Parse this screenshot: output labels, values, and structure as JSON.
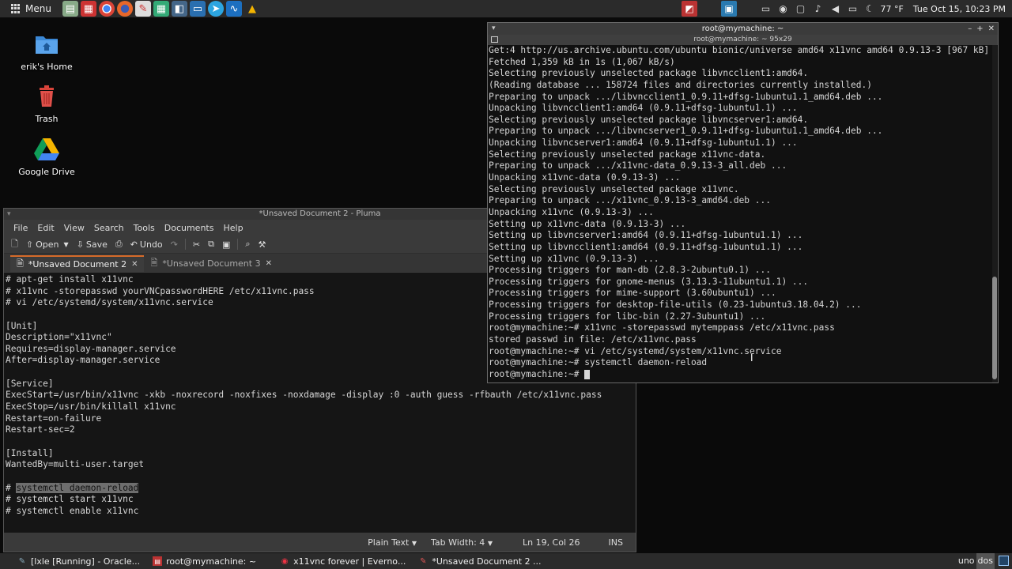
{
  "top_panel": {
    "menu_label": "Menu",
    "clock": "Tue Oct 15, 10:23 PM",
    "weather": "77 °F",
    "launchers": [
      "files-icon",
      "presentation-icon",
      "chrome-icon",
      "firefox-icon",
      "text-editor-icon",
      "spreadsheet-icon",
      "screenshot-icon",
      "remote-desktop-icon",
      "telegram-icon",
      "waveform-icon",
      "google-drive-icon"
    ]
  },
  "desktop": {
    "icons": [
      {
        "label": "erik's Home"
      },
      {
        "label": "Trash"
      },
      {
        "label": "Google Drive"
      }
    ]
  },
  "pluma": {
    "title": "*Unsaved Document 2 - Pluma",
    "menu": [
      "File",
      "Edit",
      "View",
      "Search",
      "Tools",
      "Documents",
      "Help"
    ],
    "toolbar": {
      "open": "Open",
      "save": "Save",
      "undo": "Undo"
    },
    "tabs": [
      {
        "label": "*Unsaved Document 2"
      },
      {
        "label": "*Unsaved Document 3"
      }
    ],
    "lines": [
      "# apt-get install x11vnc",
      "# x11vnc -storepasswd yourVNCpasswordHERE /etc/x11vnc.pass",
      "# vi /etc/systemd/system/x11vnc.service",
      "",
      "[Unit]",
      "Description=\"x11vnc\"",
      "Requires=display-manager.service",
      "After=display-manager.service",
      "",
      "[Service]",
      "ExecStart=/usr/bin/x11vnc -xkb -noxrecord -noxfixes -noxdamage -display :0 -auth guess -rfbauth /etc/x11vnc.pass",
      "ExecStop=/usr/bin/killall x11vnc",
      "Restart=on-failure",
      "Restart-sec=2",
      "",
      "[Install]",
      "WantedBy=multi-user.target",
      "",
      "# ",
      "# systemctl start x11vnc",
      "# systemctl enable x11vnc"
    ],
    "selected_text": "systemctl daemon-reload",
    "status": {
      "mode": "Plain Text",
      "tab_width": "Tab Width:  4",
      "position": "Ln 19, Col 26",
      "ins": "INS"
    }
  },
  "terminal": {
    "title": "root@mymachine: ~",
    "subtitle": "root@mymachine: ~ 95x29",
    "lines": [
      "Get:4 http://us.archive.ubuntu.com/ubuntu bionic/universe amd64 x11vnc amd64 0.9.13-3 [967 kB]",
      "Fetched 1,359 kB in 1s (1,067 kB/s)",
      "Selecting previously unselected package libvncclient1:amd64.",
      "(Reading database ... 158724 files and directories currently installed.)",
      "Preparing to unpack .../libvncclient1_0.9.11+dfsg-1ubuntu1.1_amd64.deb ...",
      "Unpacking libvncclient1:amd64 (0.9.11+dfsg-1ubuntu1.1) ...",
      "Selecting previously unselected package libvncserver1:amd64.",
      "Preparing to unpack .../libvncserver1_0.9.11+dfsg-1ubuntu1.1_amd64.deb ...",
      "Unpacking libvncserver1:amd64 (0.9.11+dfsg-1ubuntu1.1) ...",
      "Selecting previously unselected package x11vnc-data.",
      "Preparing to unpack .../x11vnc-data_0.9.13-3_all.deb ...",
      "Unpacking x11vnc-data (0.9.13-3) ...",
      "Selecting previously unselected package x11vnc.",
      "Preparing to unpack .../x11vnc_0.9.13-3_amd64.deb ...",
      "Unpacking x11vnc (0.9.13-3) ...",
      "Setting up x11vnc-data (0.9.13-3) ...",
      "Setting up libvncserver1:amd64 (0.9.11+dfsg-1ubuntu1.1) ...",
      "Setting up libvncclient1:amd64 (0.9.11+dfsg-1ubuntu1.1) ...",
      "Setting up x11vnc (0.9.13-3) ...",
      "Processing triggers for man-db (2.8.3-2ubuntu0.1) ...",
      "Processing triggers for gnome-menus (3.13.3-11ubuntu1.1) ...",
      "Processing triggers for mime-support (3.60ubuntu1) ...",
      "Processing triggers for desktop-file-utils (0.23-1ubuntu3.18.04.2) ...",
      "Processing triggers for libc-bin (2.27-3ubuntu1) ...",
      "root@mymachine:~# x11vnc -storepasswd mytemppass /etc/x11vnc.pass",
      "stored passwd in file: /etc/x11vnc.pass",
      "root@mymachine:~# vi /etc/systemd/system/x11vnc.service",
      "root@mymachine:~# systemctl daemon-reload",
      "root@mymachine:~# "
    ]
  },
  "taskbar": {
    "tasks": [
      {
        "label": "[lxle [Running] - Oracle..."
      },
      {
        "label": "root@mymachine: ~"
      },
      {
        "label": "x11vnc forever | Everno..."
      },
      {
        "label": "*Unsaved Document 2 ..."
      }
    ],
    "workspaces": [
      "uno",
      "dos"
    ]
  },
  "colors": {
    "accent": "#d76b2a",
    "panel": "#2b2b2b",
    "desktop": "#0a0a0a"
  }
}
